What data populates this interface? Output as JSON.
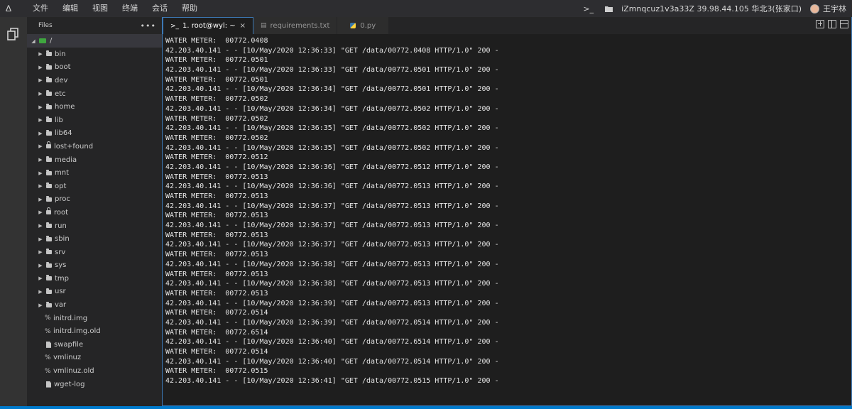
{
  "menubar": {
    "logo": "∆",
    "items": [
      "文件",
      "编辑",
      "视图",
      "终端",
      "会话",
      "帮助"
    ],
    "terminal_icon": ">_",
    "server": "iZmnqcuz1v3a33Z 39.98.44.105 华北3(张家口)",
    "user": "王宇林"
  },
  "sidebar": {
    "title": "Files",
    "more": "•••",
    "root_label": "/",
    "entries": [
      {
        "name": "bin",
        "kind": "folder"
      },
      {
        "name": "boot",
        "kind": "folder"
      },
      {
        "name": "dev",
        "kind": "folder"
      },
      {
        "name": "etc",
        "kind": "folder"
      },
      {
        "name": "home",
        "kind": "folder"
      },
      {
        "name": "lib",
        "kind": "folder"
      },
      {
        "name": "lib64",
        "kind": "folder"
      },
      {
        "name": "lost+found",
        "kind": "locked"
      },
      {
        "name": "media",
        "kind": "folder"
      },
      {
        "name": "mnt",
        "kind": "folder"
      },
      {
        "name": "opt",
        "kind": "folder"
      },
      {
        "name": "proc",
        "kind": "folder"
      },
      {
        "name": "root",
        "kind": "locked"
      },
      {
        "name": "run",
        "kind": "folder"
      },
      {
        "name": "sbin",
        "kind": "folder"
      },
      {
        "name": "srv",
        "kind": "folder"
      },
      {
        "name": "sys",
        "kind": "folder"
      },
      {
        "name": "tmp",
        "kind": "folder"
      },
      {
        "name": "usr",
        "kind": "folder"
      },
      {
        "name": "var",
        "kind": "folder"
      },
      {
        "name": "initrd.img",
        "kind": "link"
      },
      {
        "name": "initrd.img.old",
        "kind": "link"
      },
      {
        "name": "swapfile",
        "kind": "file"
      },
      {
        "name": "vmlinuz",
        "kind": "link"
      },
      {
        "name": "vmlinuz.old",
        "kind": "link"
      },
      {
        "name": "wget-log",
        "kind": "file"
      }
    ]
  },
  "tabs": [
    {
      "label": "1. root@wyl: ~",
      "icon": ">_",
      "close": "×",
      "active": true
    },
    {
      "label": "requirements.txt",
      "icon": "▤",
      "active": false
    },
    {
      "label": "0.py",
      "icon": "py",
      "active": false
    }
  ],
  "terminal": {
    "lines": [
      "WATER METER:  00772.0408",
      "42.203.40.141 - - [10/May/2020 12:36:33] \"GET /data/00772.0408 HTTP/1.0\" 200 -",
      "WATER METER:  00772.0501",
      "42.203.40.141 - - [10/May/2020 12:36:33] \"GET /data/00772.0501 HTTP/1.0\" 200 -",
      "WATER METER:  00772.0501",
      "42.203.40.141 - - [10/May/2020 12:36:34] \"GET /data/00772.0501 HTTP/1.0\" 200 -",
      "WATER METER:  00772.0502",
      "42.203.40.141 - - [10/May/2020 12:36:34] \"GET /data/00772.0502 HTTP/1.0\" 200 -",
      "WATER METER:  00772.0502",
      "42.203.40.141 - - [10/May/2020 12:36:35] \"GET /data/00772.0502 HTTP/1.0\" 200 -",
      "WATER METER:  00772.0502",
      "42.203.40.141 - - [10/May/2020 12:36:35] \"GET /data/00772.0502 HTTP/1.0\" 200 -",
      "WATER METER:  00772.0512",
      "42.203.40.141 - - [10/May/2020 12:36:36] \"GET /data/00772.0512 HTTP/1.0\" 200 -",
      "WATER METER:  00772.0513",
      "42.203.40.141 - - [10/May/2020 12:36:36] \"GET /data/00772.0513 HTTP/1.0\" 200 -",
      "WATER METER:  00772.0513",
      "42.203.40.141 - - [10/May/2020 12:36:37] \"GET /data/00772.0513 HTTP/1.0\" 200 -",
      "WATER METER:  00772.0513",
      "42.203.40.141 - - [10/May/2020 12:36:37] \"GET /data/00772.0513 HTTP/1.0\" 200 -",
      "WATER METER:  00772.0513",
      "42.203.40.141 - - [10/May/2020 12:36:37] \"GET /data/00772.0513 HTTP/1.0\" 200 -",
      "WATER METER:  00772.0513",
      "42.203.40.141 - - [10/May/2020 12:36:38] \"GET /data/00772.0513 HTTP/1.0\" 200 -",
      "WATER METER:  00772.0513",
      "42.203.40.141 - - [10/May/2020 12:36:38] \"GET /data/00772.0513 HTTP/1.0\" 200 -",
      "WATER METER:  00772.0513",
      "42.203.40.141 - - [10/May/2020 12:36:39] \"GET /data/00772.0513 HTTP/1.0\" 200 -",
      "WATER METER:  00772.0514",
      "42.203.40.141 - - [10/May/2020 12:36:39] \"GET /data/00772.0514 HTTP/1.0\" 200 -",
      "WATER METER:  00772.6514",
      "42.203.40.141 - - [10/May/2020 12:36:40] \"GET /data/00772.6514 HTTP/1.0\" 200 -",
      "WATER METER:  00772.0514",
      "42.203.40.141 - - [10/May/2020 12:36:40] \"GET /data/00772.0514 HTTP/1.0\" 200 -",
      "WATER METER:  00772.0515",
      "42.203.40.141 - - [10/May/2020 12:36:41] \"GET /data/00772.0515 HTTP/1.0\" 200 -"
    ]
  },
  "colors": {
    "accent": "#007acc",
    "root_folder": "#3fa63f"
  }
}
